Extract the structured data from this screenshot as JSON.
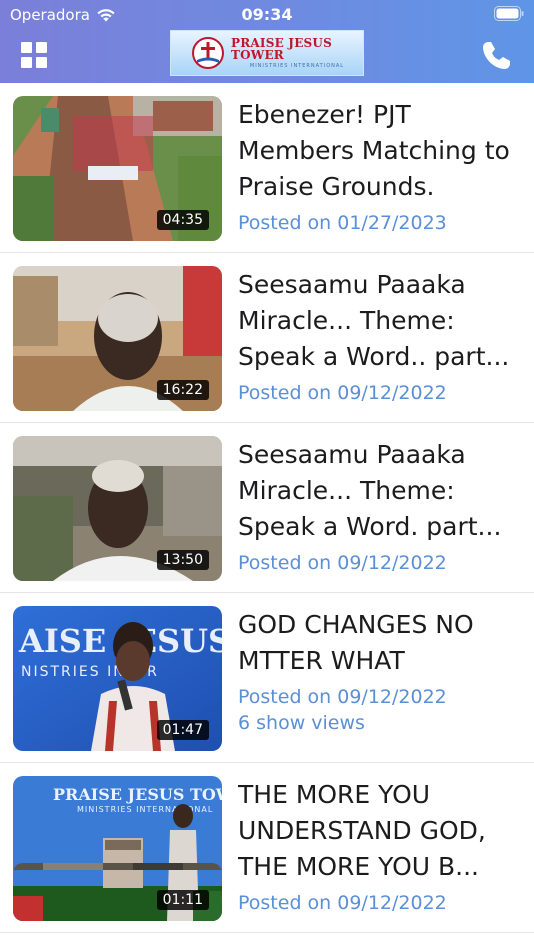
{
  "status_bar": {
    "carrier": "Operadora",
    "time": "09:34"
  },
  "header": {
    "logo_title": "PRAISE JESUS TOWER",
    "logo_subtitle": "MINISTRIES INTERNATIONAL",
    "menu_icon": "grid-icon",
    "call_icon": "phone-icon"
  },
  "videos": [
    {
      "title": "Ebenezer! PJT Members Matching to Praise Grounds.",
      "posted": "Posted on 01/27/2023",
      "duration": "04:35",
      "views": ""
    },
    {
      "title": "Seesaamu Paaaka Miracle... Theme: Speak a Word.. part...",
      "posted": "Posted on 09/12/2022",
      "duration": "16:22",
      "views": ""
    },
    {
      "title": "Seesaamu Paaaka Miracle... Theme: Speak a Word. part...",
      "posted": "Posted on 09/12/2022",
      "duration": "13:50",
      "views": ""
    },
    {
      "title": "GOD CHANGES NO MTTER WHAT",
      "posted": "Posted on 09/12/2022",
      "duration": "01:47",
      "views": "6 show views"
    },
    {
      "title": "THE MORE YOU UNDERSTAND GOD, THE MORE YOU B...",
      "posted": "Posted on 09/12/2022",
      "duration": "01:11",
      "views": ""
    }
  ],
  "thumb_text": {
    "video4": "AISE JESUS",
    "video4_sub": "NISTRIES INTER",
    "video5": "PRAISE JESUS TOWER",
    "video5_sub": "MINISTRIES INTERNATIONAL"
  },
  "colors": {
    "header_start": "#7b7fd9",
    "header_end": "#5f95e6",
    "meta_text": "#5b8fd6"
  }
}
